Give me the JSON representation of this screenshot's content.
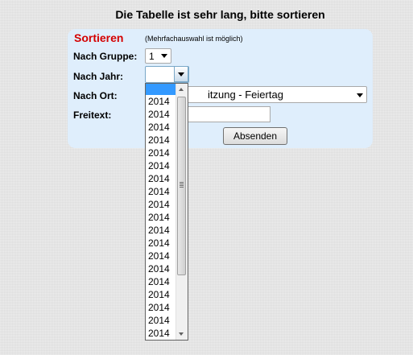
{
  "page": {
    "title": "Die Tabelle ist sehr lang, bitte sortieren"
  },
  "form": {
    "section_title": "Sortieren",
    "hint": "(Mehrfachauswahl ist möglich)",
    "group_label": "Nach Gruppe:",
    "group_value": "1",
    "year_label": "Nach Jahr:",
    "year_value": "",
    "place_label": "Nach Ort:",
    "place_value": "itzung - Feiertag",
    "freetext_label": "Freitext:",
    "freetext_value": "",
    "submit_label": "Absenden"
  },
  "year_dropdown": {
    "highlighted_option": "",
    "options": [
      "2014",
      "2014",
      "2014",
      "2014",
      "2014",
      "2014",
      "2014",
      "2014",
      "2014",
      "2014",
      "2014",
      "2014",
      "2014",
      "2014",
      "2014",
      "2014",
      "2014",
      "2014",
      "2014"
    ]
  },
  "colors": {
    "section_title": "#d40000",
    "panel_background": "#dfeefc",
    "highlight": "#3399ff"
  }
}
